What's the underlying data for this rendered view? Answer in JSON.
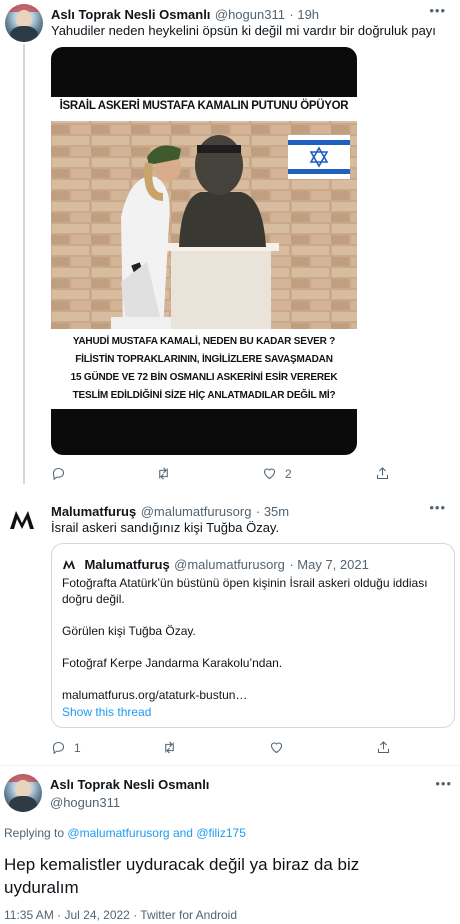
{
  "tweet1": {
    "author_name": "Aslı Toprak Nesli Osmanlı",
    "author_handle": "@hogun311",
    "time": "· 19h",
    "text": "Yahudiler neden heykelini öpsün ki değil mi vardır bir doğruluk payı",
    "image": {
      "headline": "İSRAİL ASKERİ MUSTAFA KAMALIN PUTUNU ÖPÜYOR",
      "caption_lines": [
        "YAHUDİ MUSTAFA  KAMALİ, NEDEN BU KADAR SEVER ?",
        "FİLİSTİN TOPRAKLARININ, İNGİLİZLERE SAVAŞMADAN",
        "15 GÜNDE VE 72 BİN OSMANLI ASKERİNİ ESİR VEREREK",
        "TESLİM EDİLDİĞİNİ SİZE HİÇ ANLATMADILAR  DEĞİL Mİ?"
      ]
    },
    "likes": "2"
  },
  "tweet2": {
    "author_name": "Malumatfuruş",
    "author_handle": "@malumatfurusorg",
    "time": "· 35m",
    "text": "İsrail askeri sandığınız kişi Tuğba Özay.",
    "replies": "1",
    "quote": {
      "author_name": "Malumatfuruş",
      "author_handle": "@malumatfurusorg",
      "time": "· May 7, 2021",
      "line1": "Fotoğrafta Atatürk’ün büstünü öpen kişinin İsrail askeri olduğu iddiası",
      "line2": "doğru değil.",
      "line3": "Görülen kişi Tuğba Özay.",
      "line4": "Fotoğraf Kerpe Jandarma Karakolu’ndan.",
      "line5": "malumatfurus.org/ataturk-bustun…",
      "show_thread": "Show this thread"
    }
  },
  "tweet3": {
    "author_name": "Aslı Toprak Nesli Osmanlı",
    "author_handle": "@hogun311",
    "replying_prefix": "Replying to",
    "replying_user1": "@malumatfurusorg",
    "replying_and": "and",
    "replying_user2": "@filiz175",
    "text_line1": "Hep kemalistler uyduracak değil ya biraz da biz",
    "text_line2": "uyduralım",
    "timestamp": "11:35 AM · Jul 24, 2022 · Twitter for Android"
  },
  "colors": {
    "accent": "#1d9bf0",
    "secondary_text": "#536471",
    "border": "#cfd9de"
  },
  "icons": [
    "reply-icon",
    "retweet-icon",
    "like-icon",
    "share-icon",
    "more-icon"
  ]
}
